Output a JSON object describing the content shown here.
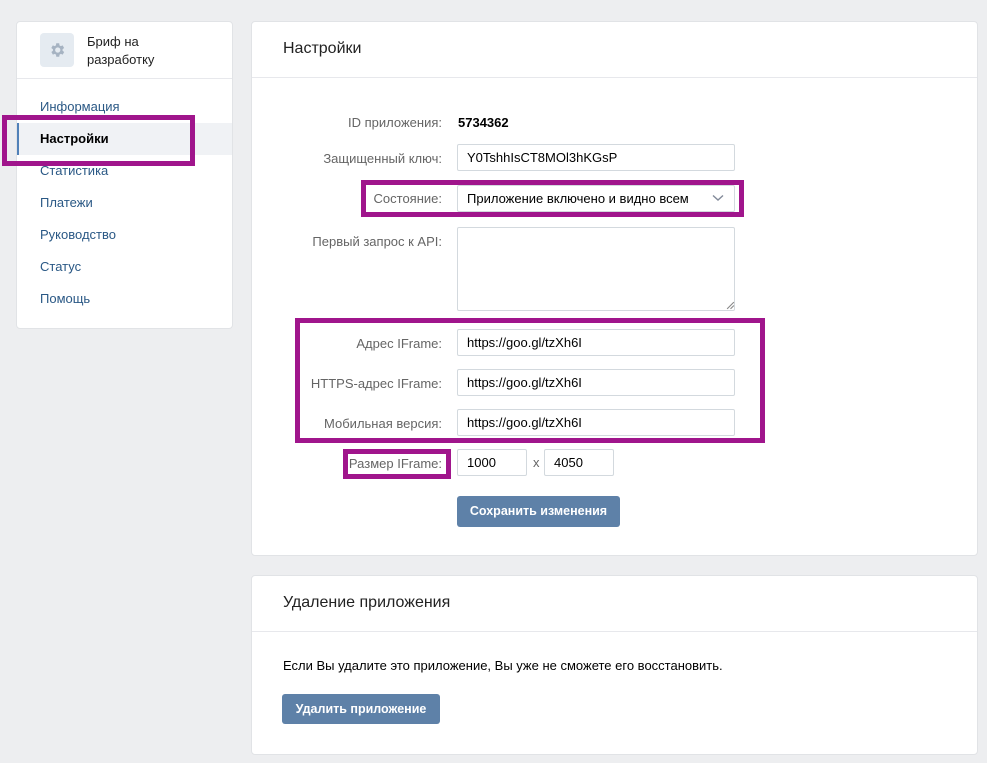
{
  "sidebar": {
    "app_title": "Бриф на разработку",
    "app_icon": "gear-icon",
    "items": [
      {
        "label": "Информация"
      },
      {
        "label": "Настройки"
      },
      {
        "label": "Статистика"
      },
      {
        "label": "Платежи"
      },
      {
        "label": "Руководство"
      },
      {
        "label": "Статус"
      },
      {
        "label": "Помощь"
      }
    ],
    "active_item": "Настройки"
  },
  "settings": {
    "title": "Настройки",
    "app_id_label": "ID приложения:",
    "app_id_value": "5734362",
    "secret_key_label": "Защищенный ключ:",
    "secret_key_value": "Y0TshhIsCT8MOl3hKGsP",
    "state_label": "Состояние:",
    "state_value": "Приложение включено и видно всем",
    "first_api_label": "Первый запрос к API:",
    "first_api_value": "",
    "iframe_address_label": "Адрес IFrame:",
    "iframe_address_value": "https://goo.gl/tzXh6I",
    "https_iframe_label": "HTTPS-адрес IFrame:",
    "https_iframe_value": "https://goo.gl/tzXh6I",
    "mobile_label": "Мобильная версия:",
    "mobile_value": "https://goo.gl/tzXh6I",
    "iframe_size_label": "Размер IFrame:",
    "iframe_width": "1000",
    "size_separator": "x",
    "iframe_height": "4050",
    "save_button": "Сохранить изменения"
  },
  "delete": {
    "title": "Удаление приложения",
    "warning": "Если Вы удалите это приложение, Вы уже не сможете его восстановить.",
    "delete_button": "Удалить приложение"
  },
  "colors": {
    "highlight": "#a0158c",
    "button": "#5e81a8",
    "link": "#2a5885",
    "background": "#edeef0"
  }
}
